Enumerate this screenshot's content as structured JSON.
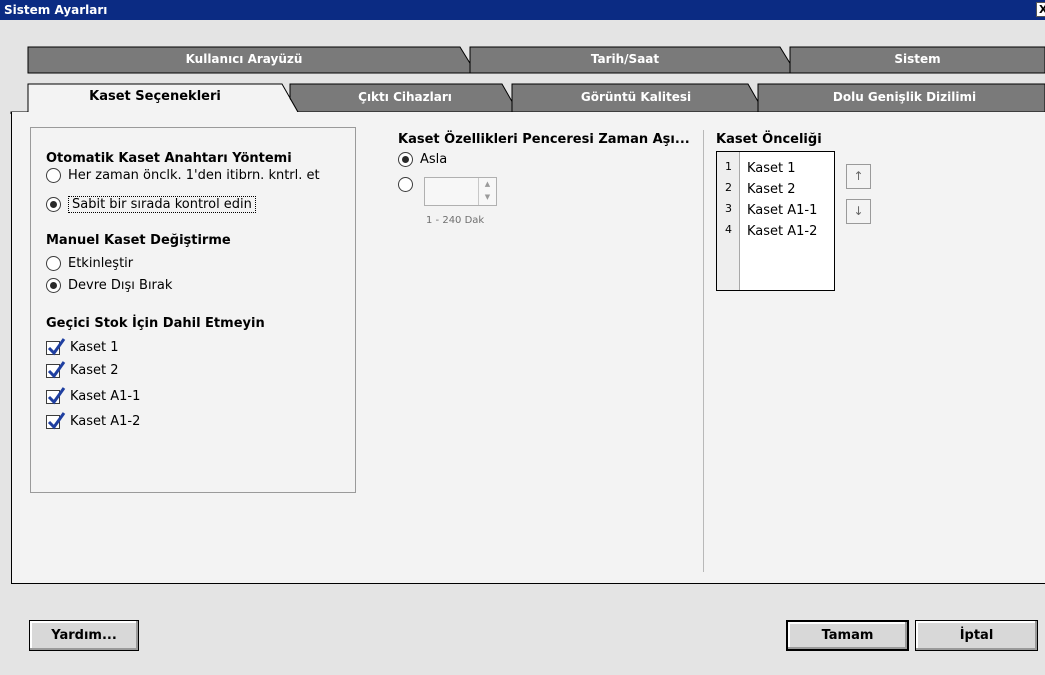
{
  "window": {
    "title": "Sistem Ayarları",
    "close_label": "X"
  },
  "tabs": {
    "back_row": [
      "Kullanıcı Arayüzü",
      "Tarih/Saat",
      "Sistem"
    ],
    "front_row": [
      "Kaset Seçenekleri",
      "Çıktı Cihazları",
      "Görüntü Kalitesi",
      "Dolu Genişlik Dizilimi"
    ],
    "active": "Kaset Seçenekleri"
  },
  "auto_tray": {
    "heading": "Otomatik Kaset Anahtarı Yöntemi",
    "options": [
      "Her zaman önclk. 1'den itibrn. kntrl. et",
      "Sabit bir sırada kontrol edin"
    ],
    "selected_index": 1
  },
  "manual_tray": {
    "heading": "Manuel Kaset Değiştirme",
    "options": [
      "Etkinleştir",
      "Devre Dışı Bırak"
    ],
    "selected_index": 1
  },
  "temp_stock": {
    "heading": "Geçici Stok İçin Dahil Etmeyin",
    "items": [
      "Kaset 1",
      "Kaset 2",
      "Kaset A1-1",
      "Kaset A1-2"
    ],
    "checked": [
      true,
      true,
      true,
      true
    ]
  },
  "timeout": {
    "heading": "Kaset Özellikleri Penceresi Zaman Aşı...",
    "never_label": "Asla",
    "selected": "never",
    "input_value": "",
    "range_hint": "1 - 240 Dak"
  },
  "priority": {
    "heading": "Kaset Önceliği",
    "numbers": [
      "1",
      "2",
      "3",
      "4"
    ],
    "items": [
      "Kaset 1",
      "Kaset 2",
      "Kaset A1-1",
      "Kaset A1-2"
    ],
    "up_icon": "↑",
    "down_icon": "↓"
  },
  "footer": {
    "help_label": "Yardım...",
    "ok_label": "Tamam",
    "cancel_label": "İptal"
  },
  "colors": {
    "titlebar": "#0b2b83",
    "tab_inactive": "#7a7a7a",
    "tab_active": "#f3f3f3",
    "window_bg": "#e4e4e4"
  }
}
